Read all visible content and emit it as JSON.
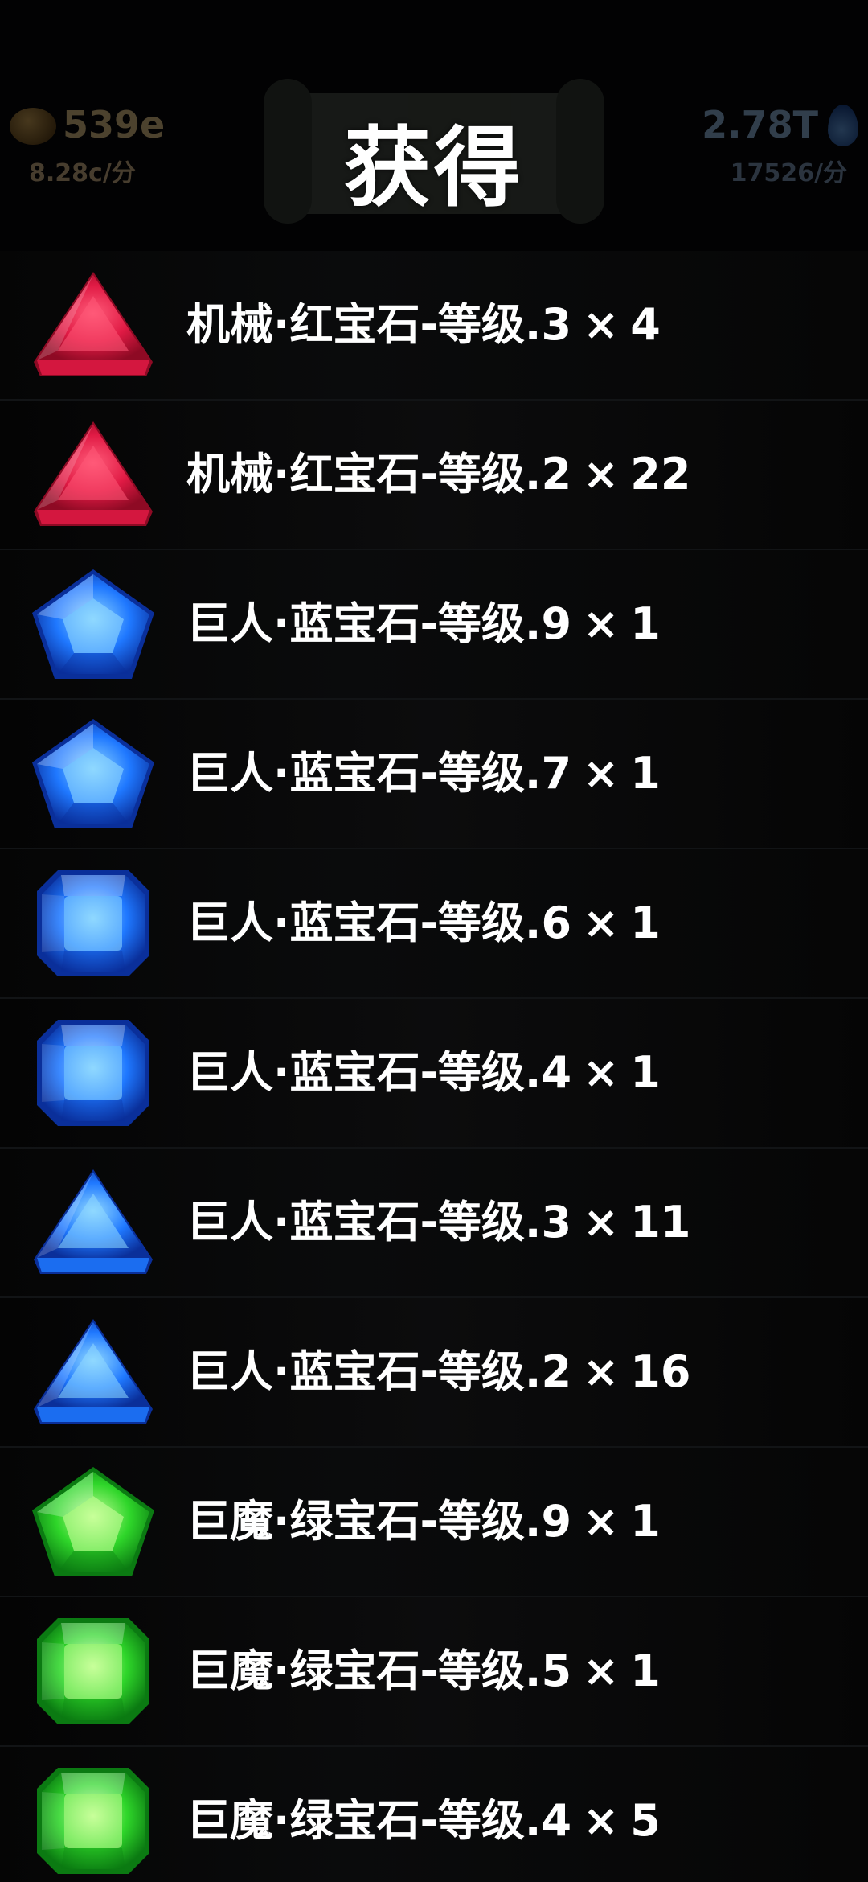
{
  "background_hud": {
    "gold_amount": "539e",
    "gold_rate": "8.28c/分",
    "mana_amount": "2.78T",
    "mana_rate": "17526/分"
  },
  "dialog": {
    "title": "获得"
  },
  "items": [
    {
      "name": "机械·红宝石-等级.3",
      "quantity": "4",
      "gem": "red",
      "shape": "triangle",
      "icon_name": "red-triangle-gem-icon"
    },
    {
      "name": "机械·红宝石-等级.2",
      "quantity": "22",
      "gem": "red",
      "shape": "triangle",
      "icon_name": "red-triangle-gem-icon"
    },
    {
      "name": "巨人·蓝宝石-等级.9",
      "quantity": "1",
      "gem": "blue",
      "shape": "pentagon",
      "icon_name": "blue-pentagon-gem-icon"
    },
    {
      "name": "巨人·蓝宝石-等级.7",
      "quantity": "1",
      "gem": "blue",
      "shape": "pentagon",
      "icon_name": "blue-pentagon-gem-icon"
    },
    {
      "name": "巨人·蓝宝石-等级.6",
      "quantity": "1",
      "gem": "blue",
      "shape": "octagon",
      "icon_name": "blue-octagon-gem-icon"
    },
    {
      "name": "巨人·蓝宝石-等级.4",
      "quantity": "1",
      "gem": "blue",
      "shape": "octagon",
      "icon_name": "blue-octagon-gem-icon"
    },
    {
      "name": "巨人·蓝宝石-等级.3",
      "quantity": "11",
      "gem": "blue",
      "shape": "triangle",
      "icon_name": "blue-triangle-gem-icon"
    },
    {
      "name": "巨人·蓝宝石-等级.2",
      "quantity": "16",
      "gem": "blue",
      "shape": "triangle",
      "icon_name": "blue-triangle-gem-icon"
    },
    {
      "name": "巨魔·绿宝石-等级.9",
      "quantity": "1",
      "gem": "green",
      "shape": "pentagon",
      "icon_name": "green-pentagon-gem-icon"
    },
    {
      "name": "巨魔·绿宝石-等级.5",
      "quantity": "1",
      "gem": "green",
      "shape": "octagon",
      "icon_name": "green-octagon-gem-icon"
    },
    {
      "name": "巨魔·绿宝石-等级.4",
      "quantity": "5",
      "gem": "green",
      "shape": "octagon",
      "icon_name": "green-octagon-gem-icon"
    }
  ],
  "multiply_sign": "×",
  "colors": {
    "red_light": "#ff5a78",
    "red_mid": "#e01a44",
    "red_dark": "#8e0a24",
    "blue_light": "#8fd8ff",
    "blue_mid": "#1f78ff",
    "blue_dark": "#0a2f9a",
    "green_light": "#c8ff9a",
    "green_mid": "#2fd62a",
    "green_dark": "#0b7a12"
  }
}
